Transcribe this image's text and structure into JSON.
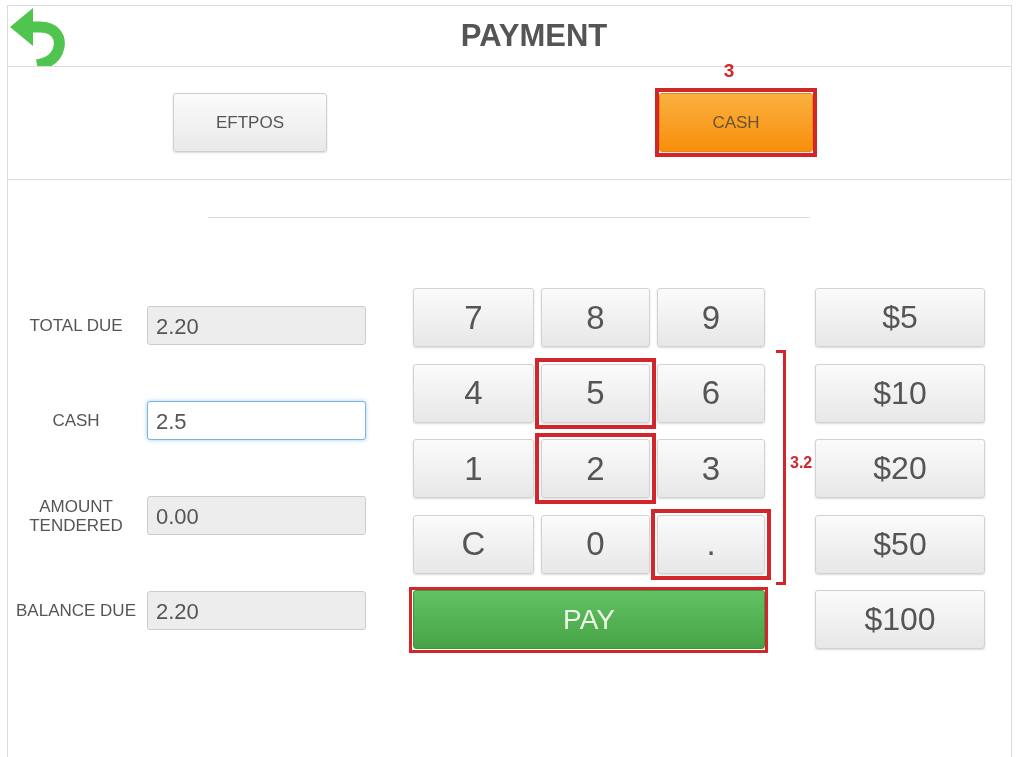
{
  "header": {
    "title": "PAYMENT"
  },
  "payment_methods": [
    {
      "label": "EFTPOS",
      "selected": false,
      "highlighted": false
    },
    {
      "label": "CASH",
      "selected": true,
      "highlighted": true,
      "annotation": "3"
    }
  ],
  "fields": [
    {
      "label": "TOTAL DUE",
      "value": "2.20",
      "readonly": true,
      "focused": false
    },
    {
      "label": "CASH",
      "value": "2.5",
      "readonly": false,
      "focused": true
    },
    {
      "label": "AMOUNT TENDERED",
      "value": "0.00",
      "readonly": true,
      "focused": false
    },
    {
      "label": "BALANCE DUE",
      "value": "2.20",
      "readonly": true,
      "focused": false
    }
  ],
  "keypad": {
    "keys": [
      {
        "label": "7",
        "highlighted": false
      },
      {
        "label": "8",
        "highlighted": false
      },
      {
        "label": "9",
        "highlighted": false
      },
      {
        "label": "4",
        "highlighted": false
      },
      {
        "label": "5",
        "highlighted": true
      },
      {
        "label": "6",
        "highlighted": false
      },
      {
        "label": "1",
        "highlighted": false
      },
      {
        "label": "2",
        "highlighted": true
      },
      {
        "label": "3",
        "highlighted": false
      },
      {
        "label": "C",
        "highlighted": false
      },
      {
        "label": "0",
        "highlighted": false
      },
      {
        "label": ".",
        "highlighted": true
      }
    ],
    "pay_button": {
      "label": "PAY",
      "highlighted": true
    },
    "bracket_label": "3.2"
  },
  "quick_amounts": [
    "$5",
    "$10",
    "$20",
    "$50",
    "$100"
  ]
}
